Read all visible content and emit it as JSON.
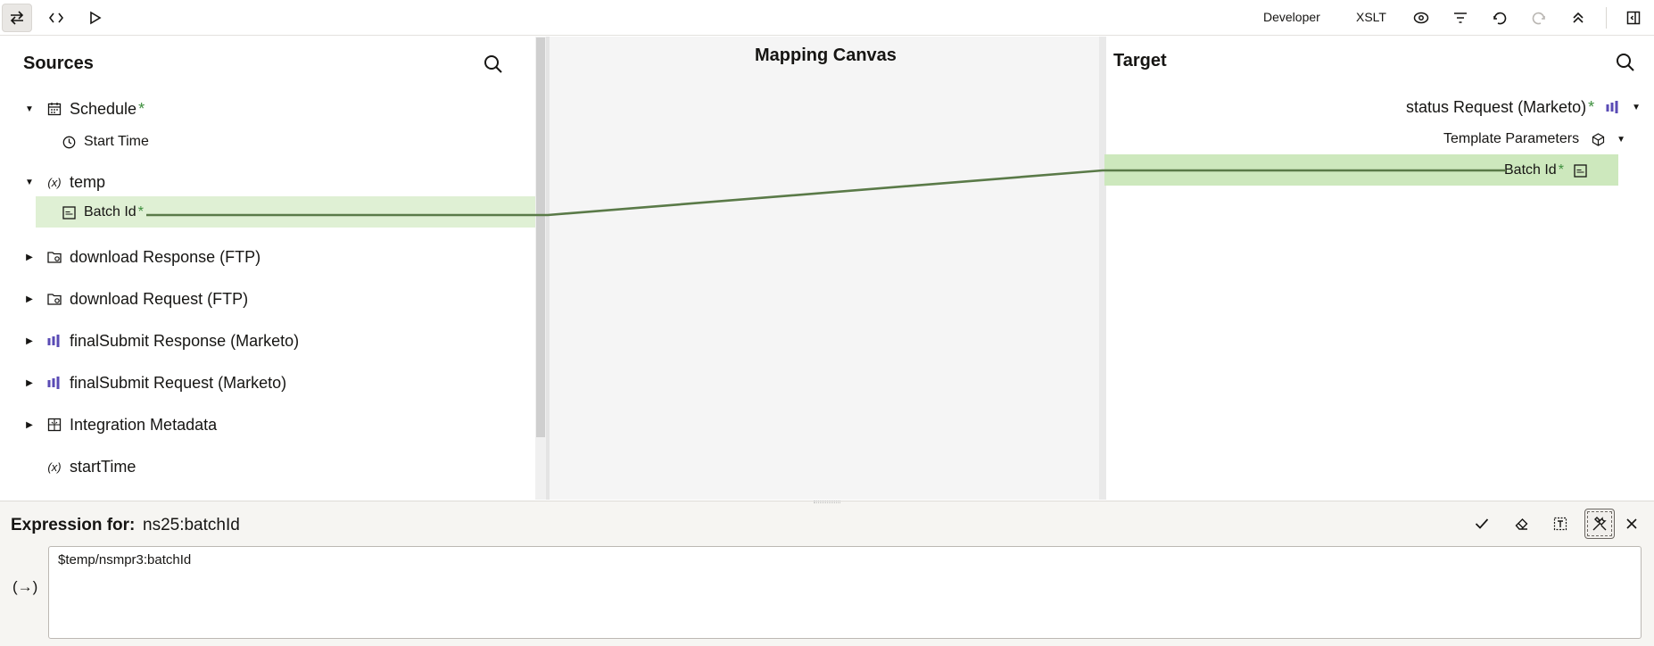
{
  "toolbar": {
    "mode_label": "Developer",
    "xslt_label": "XSLT",
    "icons": [
      "swap-icon",
      "code-icon",
      "play-icon",
      "eye-icon",
      "filter-icon",
      "undo-icon",
      "redo-icon",
      "collapse-icon",
      "panel-toggle-icon"
    ]
  },
  "sources": {
    "title": "Sources",
    "items": [
      {
        "label": "Schedule",
        "required": "*",
        "icon": "calendar-icon",
        "expanded": true
      },
      {
        "label": "Start Time",
        "icon": "clock-icon"
      },
      {
        "label": "temp",
        "icon": "variable-icon",
        "expanded": true
      },
      {
        "label": "Batch Id",
        "required": "*",
        "icon": "string-icon",
        "mapped": true
      },
      {
        "label": "download Response (FTP)",
        "icon": "folder-icon",
        "expanded": false
      },
      {
        "label": "download Request (FTP)",
        "icon": "folder-icon",
        "expanded": false
      },
      {
        "label": "finalSubmit Response (Marketo)",
        "icon": "marketo-icon",
        "expanded": false
      },
      {
        "label": "finalSubmit Request (Marketo)",
        "icon": "marketo-icon",
        "expanded": false
      },
      {
        "label": "Integration Metadata",
        "icon": "metadata-icon",
        "expanded": false
      },
      {
        "label": "startTime",
        "icon": "variable-icon"
      }
    ]
  },
  "canvas": {
    "title": "Mapping Canvas"
  },
  "target": {
    "title": "Target",
    "items": [
      {
        "label": "status Request (Marketo)",
        "required": "*",
        "icon": "marketo-icon"
      },
      {
        "label": "Template Parameters",
        "icon": "cube-icon"
      },
      {
        "label": "Batch Id",
        "required": "*",
        "icon": "string-icon",
        "mapped": true
      }
    ]
  },
  "expression": {
    "label": "Expression for:",
    "target_name": "ns25:batchId",
    "value": "$temp/nsmpr3:batchId",
    "side_symbol": "(→)"
  },
  "colors": {
    "mapping_line": "#5a7a48",
    "highlight": "#dff0d4",
    "required_star": "#3d8f3d",
    "marketo": "#5a4bb5"
  }
}
